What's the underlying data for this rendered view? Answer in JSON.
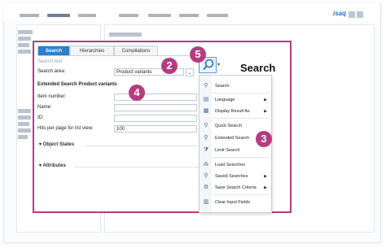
{
  "app": {
    "brand": "isaq"
  },
  "tabs": [
    {
      "label": "Search",
      "active": true
    },
    {
      "label": "Hierarchies",
      "active": false
    },
    {
      "label": "Compilations",
      "active": false
    }
  ],
  "form": {
    "search_text_label": "Search text:",
    "search_area_label": "Search area:",
    "search_area_value": "Product variants",
    "heading": "Extended Search Product variants",
    "item_number_label": "Item number:",
    "name_label": "Name:",
    "id_label": "ID:",
    "hits_label": "Hits per page for list view:",
    "hits_value": "100",
    "section_object_states": "Object States",
    "section_attributes": "Attributes"
  },
  "search_panel_title": "Search",
  "badges": [
    "2",
    "5",
    "4",
    "3"
  ],
  "menu": {
    "items": [
      {
        "label": "Search",
        "icon": "search-icon"
      },
      {
        "label": "Language",
        "icon": "language-icon",
        "submenu": true
      },
      {
        "label": "Display Result As",
        "icon": "display-icon",
        "submenu": true
      },
      {
        "label": "Quick Search",
        "icon": "search-icon"
      },
      {
        "label": "Extended Search",
        "icon": "extended-search-icon"
      },
      {
        "label": "Limit Search",
        "icon": "limit-icon"
      },
      {
        "label": "Load Searches",
        "icon": "load-icon"
      },
      {
        "label": "Saved Searches",
        "icon": "search-icon",
        "submenu": true
      },
      {
        "label": "Save Search Criteria",
        "icon": "save-icon",
        "submenu": true
      },
      {
        "label": "Clear Input Fields",
        "icon": "clear-icon"
      }
    ]
  },
  "colors": {
    "accent": "#b43c7f",
    "tab_active": "#2f7fc4"
  }
}
